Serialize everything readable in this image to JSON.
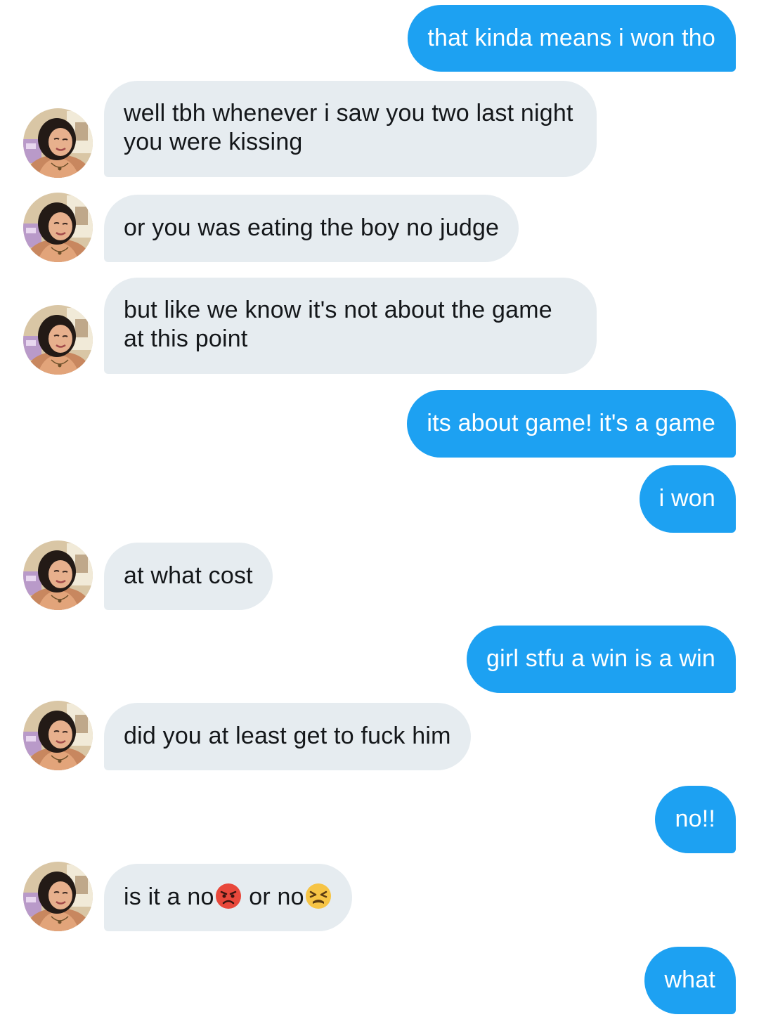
{
  "conversation": {
    "messages": [
      {
        "from": "me",
        "text": "that kinda means i won tho"
      },
      {
        "from": "them",
        "text": "well tbh whenever i saw you two last night you were kissing"
      },
      {
        "from": "them",
        "text": "or you was eating the boy no judge"
      },
      {
        "from": "them",
        "text": "but like we know it's not about the game at this point"
      },
      {
        "from": "me",
        "text": "its about game! it's a game"
      },
      {
        "from": "me",
        "text": "i won"
      },
      {
        "from": "them",
        "text": "at what cost"
      },
      {
        "from": "me",
        "text": "girl stfu a win is a win"
      },
      {
        "from": "them",
        "text": "did you at least get to fuck him"
      },
      {
        "from": "me",
        "text": "no!!"
      },
      {
        "from": "them",
        "text_a": "is it a no",
        "emoji_a": "angry-face",
        "text_b": " or no",
        "emoji_b": "tired-face"
      },
      {
        "from": "me",
        "text": "what"
      }
    ]
  },
  "colors": {
    "outgoing_bubble": "#1da1f2",
    "incoming_bubble": "#e6ecf0",
    "incoming_text": "#14171a",
    "background": "#ffffff"
  },
  "icons": {
    "avatar": "user-avatar-photo"
  }
}
